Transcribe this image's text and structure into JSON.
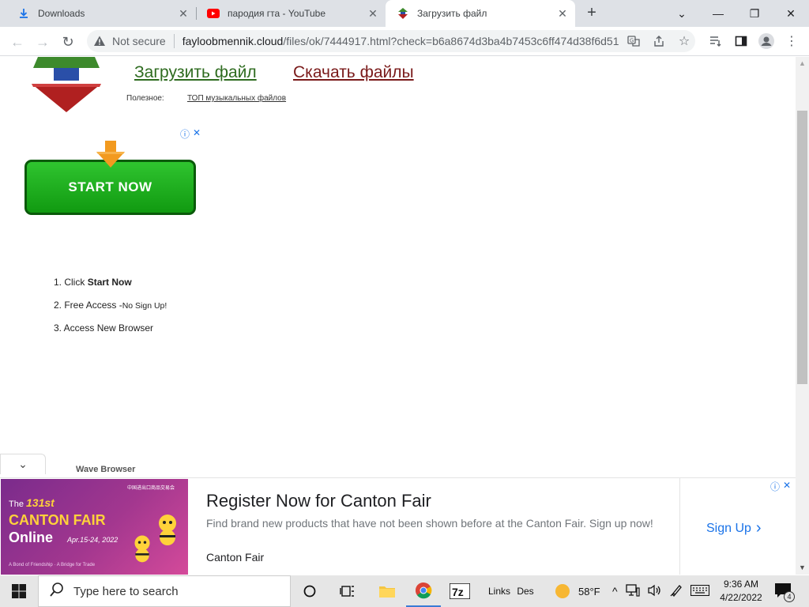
{
  "browser": {
    "tabs": [
      {
        "title": "Downloads",
        "icon": "download-icon"
      },
      {
        "title": "пародия гта - YouTube",
        "icon": "youtube-icon"
      },
      {
        "title": "Загрузить файл",
        "icon": "site-logo-icon"
      }
    ],
    "active_tab": 2,
    "security_label": "Not secure",
    "url_host": "fayloobmennik.cloud",
    "url_rest": "/files/ok/7444917.html?check=b6a8674d3ba4b7453c6ff474d38f6d51"
  },
  "page": {
    "nav_upload": "Загрузить файл",
    "nav_download": "Скачать файлы",
    "useful_label": "Полезное:",
    "useful_link": "ТОП музыкальных файлов",
    "start_button": "START NOW",
    "steps": {
      "s1_prefix": "1. Click ",
      "s1_bold": "Start Now",
      "s2_prefix": "2. Free Access -",
      "s2_small": "No Sign Up!",
      "s3": "3. Access New Browser"
    },
    "wave_label": "Wave Browser"
  },
  "bottom_ad": {
    "image": {
      "the": "The",
      "number": "131st",
      "line1": "CANTON FAIR",
      "line2": "Online",
      "dates": "Apr.15-24, 2022",
      "tagline": "A Bond of Friendship · A Bridge for Trade"
    },
    "headline": "Register Now for Canton Fair",
    "description": "Find brand new products that have not been shown before at the Canton Fair. Sign up now!",
    "source": "Canton Fair",
    "cta": "Sign Up"
  },
  "taskbar": {
    "search_placeholder": "Type here to search",
    "links_label": "Links",
    "des_label": "Des",
    "temperature": "58°F",
    "time": "9:36 AM",
    "date": "4/22/2022",
    "notification_count": "4"
  },
  "colors": {
    "accent_blue": "#1a73e8",
    "upload_green": "#2e6b1f",
    "download_red": "#7a1a1a",
    "start_green": "#119a11"
  }
}
